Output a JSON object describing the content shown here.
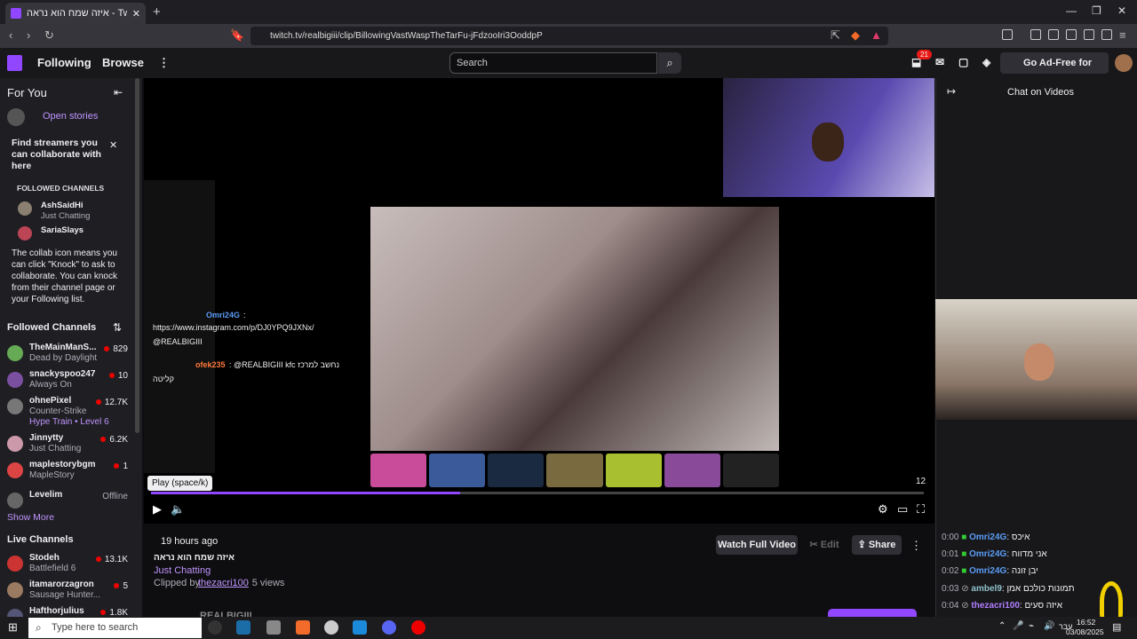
{
  "browser": {
    "tab_title": "איזה שמח הוא נראה - Twitch",
    "new_tab": "+",
    "url": "twitch.tv/realbigiii/clip/BillowingVastWaspTheTarFu-jFdzooIri3OoddpP"
  },
  "topnav": {
    "following": "Following",
    "browse": "Browse",
    "more": "⋮",
    "search_placeholder": "Search",
    "notif_count": "21",
    "ad_free": "Go Ad-Free for Free"
  },
  "sidebar": {
    "for_you": "For You",
    "open_stories": "Open stories",
    "collab_title": "Find streamers you can collaborate with here",
    "followed_channels_caps": "FOLLOWED CHANNELS",
    "collab_channels": [
      {
        "name": "AshSaidHi",
        "game": "Just Chatting"
      },
      {
        "name": "SariaSlays",
        "game": ""
      }
    ],
    "collab_text": "The collab icon means you can click \"Knock\" to ask to collaborate. You can knock from their channel page or your Following list.",
    "followed_title": "Followed Channels",
    "followed": [
      {
        "name": "TheMainManS...",
        "game": "Dead by Daylight",
        "viewers": "829"
      },
      {
        "name": "snackyspoo247",
        "game": "Always On",
        "viewers": "10"
      },
      {
        "name": "ohnePixel",
        "game": "Counter-Strike",
        "viewers": "12.7K",
        "extra": "Hype Train • Level 6"
      },
      {
        "name": "Jinnytty",
        "game": "Just Chatting",
        "viewers": "6.2K"
      },
      {
        "name": "maplestorybgm",
        "game": "MapleStory",
        "viewers": "1"
      },
      {
        "name": "Levelim",
        "game": "",
        "viewers": "Offline"
      }
    ],
    "show_more": "Show More",
    "live_title": "Live Channels",
    "live": [
      {
        "name": "Stodeh",
        "game": "Battlefield 6",
        "viewers": "13.1K"
      },
      {
        "name": "itamarorzagron",
        "game": "Sausage Hunter...",
        "viewers": "5"
      },
      {
        "name": "Hafthorjulius",
        "game": "",
        "viewers": "1.8K"
      }
    ]
  },
  "player": {
    "tooltip": "Play (space/k)",
    "clip_count": "12",
    "overlay_chat": [
      {
        "user": "Omri24G",
        "text": ":"
      },
      {
        "user": "",
        "text": "https://www.instagram.com/p/DJ0YPQ9JXNx/"
      },
      {
        "user": "",
        "text": "@REALBIGIII"
      },
      {
        "user": "ofek235",
        "text": ": @REALBIGIII kfc נחשב למרכז"
      },
      {
        "user": "",
        "text": "קליטה"
      }
    ]
  },
  "clip": {
    "time_ago": "19 hours ago",
    "title": "איזה שמח הוא נראה",
    "category": "Just Chatting",
    "clipped_by_label": "Clipped by",
    "clipper": "thezacri100",
    "views": "· 5 views",
    "watch_full": "Watch Full Video",
    "edit": "Edit",
    "share": "Share",
    "channel_partial": "REALBIGIII"
  },
  "chat": {
    "title": "Chat on Videos",
    "messages": [
      {
        "ts": "0:00",
        "user": "Omri24G",
        "text": ": איכס",
        "color": "#5b9cf5"
      },
      {
        "ts": "0:01",
        "user": "Omri24G",
        "text": ": אני מדווח",
        "color": "#5b9cf5"
      },
      {
        "ts": "0:02",
        "user": "Omri24G",
        "text": ": יבן זונה",
        "color": "#5b9cf5"
      },
      {
        "ts": "0:03",
        "user": "ambel9",
        "text": ": תמונות כולכם אמן",
        "color": "#8fc1c8"
      },
      {
        "ts": "0:04",
        "user": "thezacri100",
        "text": ": איזה סעים",
        "color": "#b07fff"
      }
    ]
  },
  "taskbar": {
    "search": "Type here to search",
    "lang": "עבר",
    "time": "16:52",
    "date": "03/08/2025"
  },
  "colors": {
    "accent": "#9147ff",
    "live": "#eb0400"
  }
}
